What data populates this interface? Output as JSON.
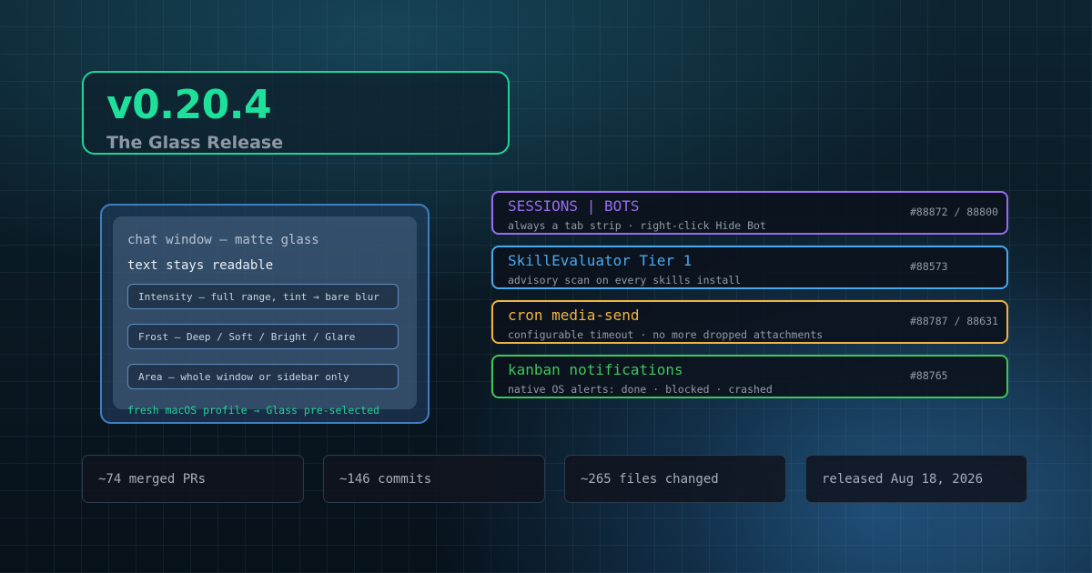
{
  "header": {
    "version": "v0.20.4",
    "release_name": "The Glass Release",
    "accent_color": "#1ee09a"
  },
  "glass_panel": {
    "title": "chat window — matte glass",
    "subtitle": "text stays readable",
    "options": [
      {
        "label": "Intensity — full range, tint → bare blur"
      },
      {
        "label": "Frost — Deep / Soft / Bright / Glare"
      },
      {
        "label": "Area — whole window or sidebar only"
      }
    ],
    "note": "fresh macOS profile → Glass pre-selected"
  },
  "features": [
    {
      "title": "SESSIONS | BOTS",
      "desc": "always a tab strip · right-click Hide Bot",
      "ref": "#88872 / 88800",
      "color": "#9b6bf0"
    },
    {
      "title": "SkillEvaluator Tier 1",
      "desc": "advisory scan on every skills install",
      "ref": "#88573",
      "color": "#4aa8ee"
    },
    {
      "title": "cron media-send",
      "desc": "configurable timeout · no more dropped attachments",
      "ref": "#88787 / 88631",
      "color": "#f0b446"
    },
    {
      "title": "kanban notifications",
      "desc": "native OS alerts: done · blocked · crashed",
      "ref": "#88765",
      "color": "#3ec65a"
    }
  ],
  "stats": [
    {
      "label": "~74 merged PRs"
    },
    {
      "label": "~146 commits"
    },
    {
      "label": "~265 files changed"
    },
    {
      "label": "released Aug 18, 2026"
    }
  ]
}
